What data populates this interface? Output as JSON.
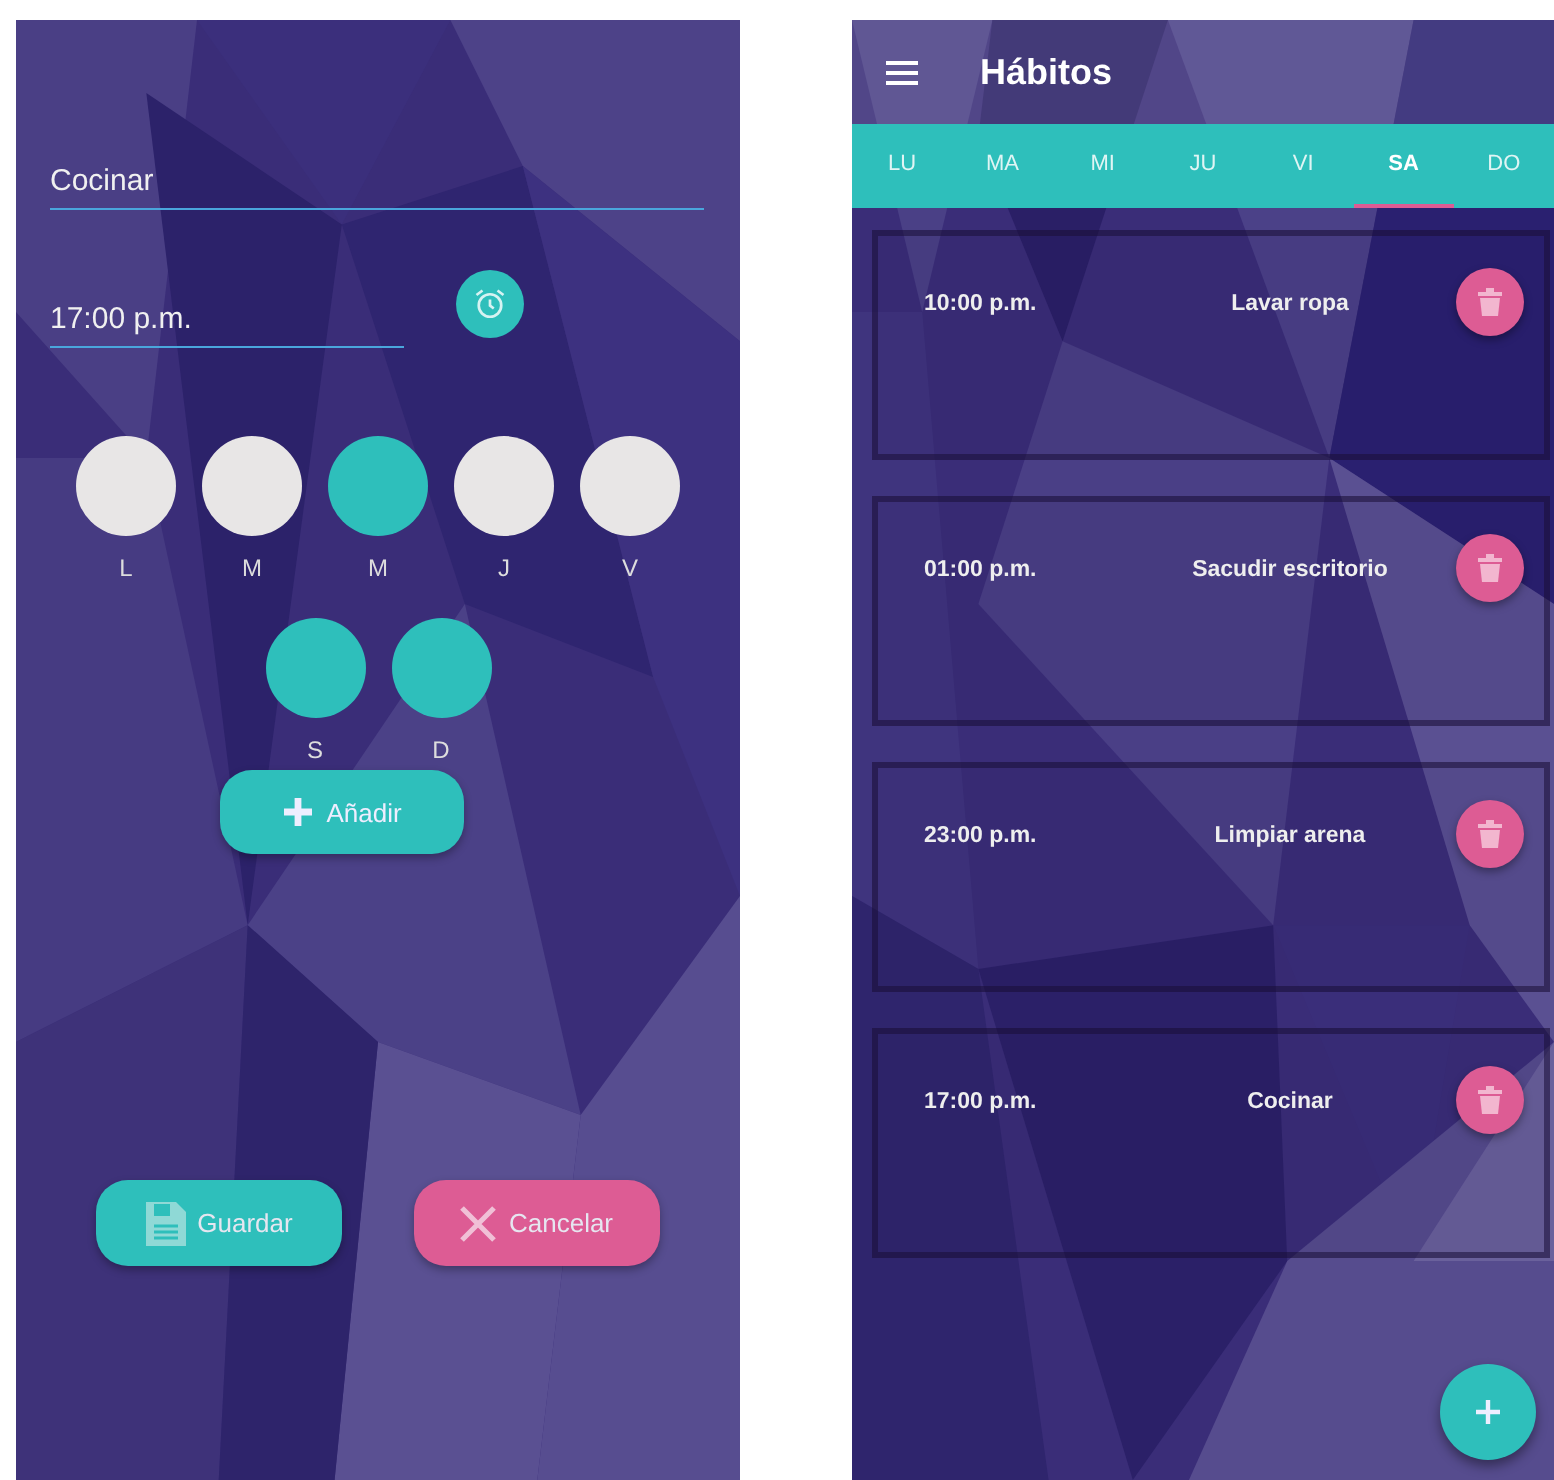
{
  "form": {
    "name_field": "Cocinar",
    "time_field": "17:00 p.m.",
    "days": [
      {
        "label": "L",
        "selected": false
      },
      {
        "label": "M",
        "selected": false
      },
      {
        "label": "M",
        "selected": true
      },
      {
        "label": "J",
        "selected": false
      },
      {
        "label": "V",
        "selected": false
      },
      {
        "label": "S",
        "selected": true
      },
      {
        "label": "D",
        "selected": true
      }
    ],
    "add_button": "Añadir",
    "save_button": "Guardar",
    "cancel_button": "Cancelar"
  },
  "habits_screen": {
    "title": "Hábitos",
    "tabs": [
      {
        "label": "LU",
        "selected": false
      },
      {
        "label": "MA",
        "selected": false
      },
      {
        "label": "MI",
        "selected": false
      },
      {
        "label": "JU",
        "selected": false
      },
      {
        "label": "VI",
        "selected": false
      },
      {
        "label": "SA",
        "selected": true
      },
      {
        "label": "DO",
        "selected": false
      }
    ],
    "habits": [
      {
        "time": "10:00 p.m.",
        "name": "Lavar ropa"
      },
      {
        "time": "01:00 p.m.",
        "name": "Sacudir escritorio"
      },
      {
        "time": "23:00 p.m.",
        "name": "Limpiar arena"
      },
      {
        "time": "17:00 p.m.",
        "name": "Cocinar"
      }
    ]
  }
}
